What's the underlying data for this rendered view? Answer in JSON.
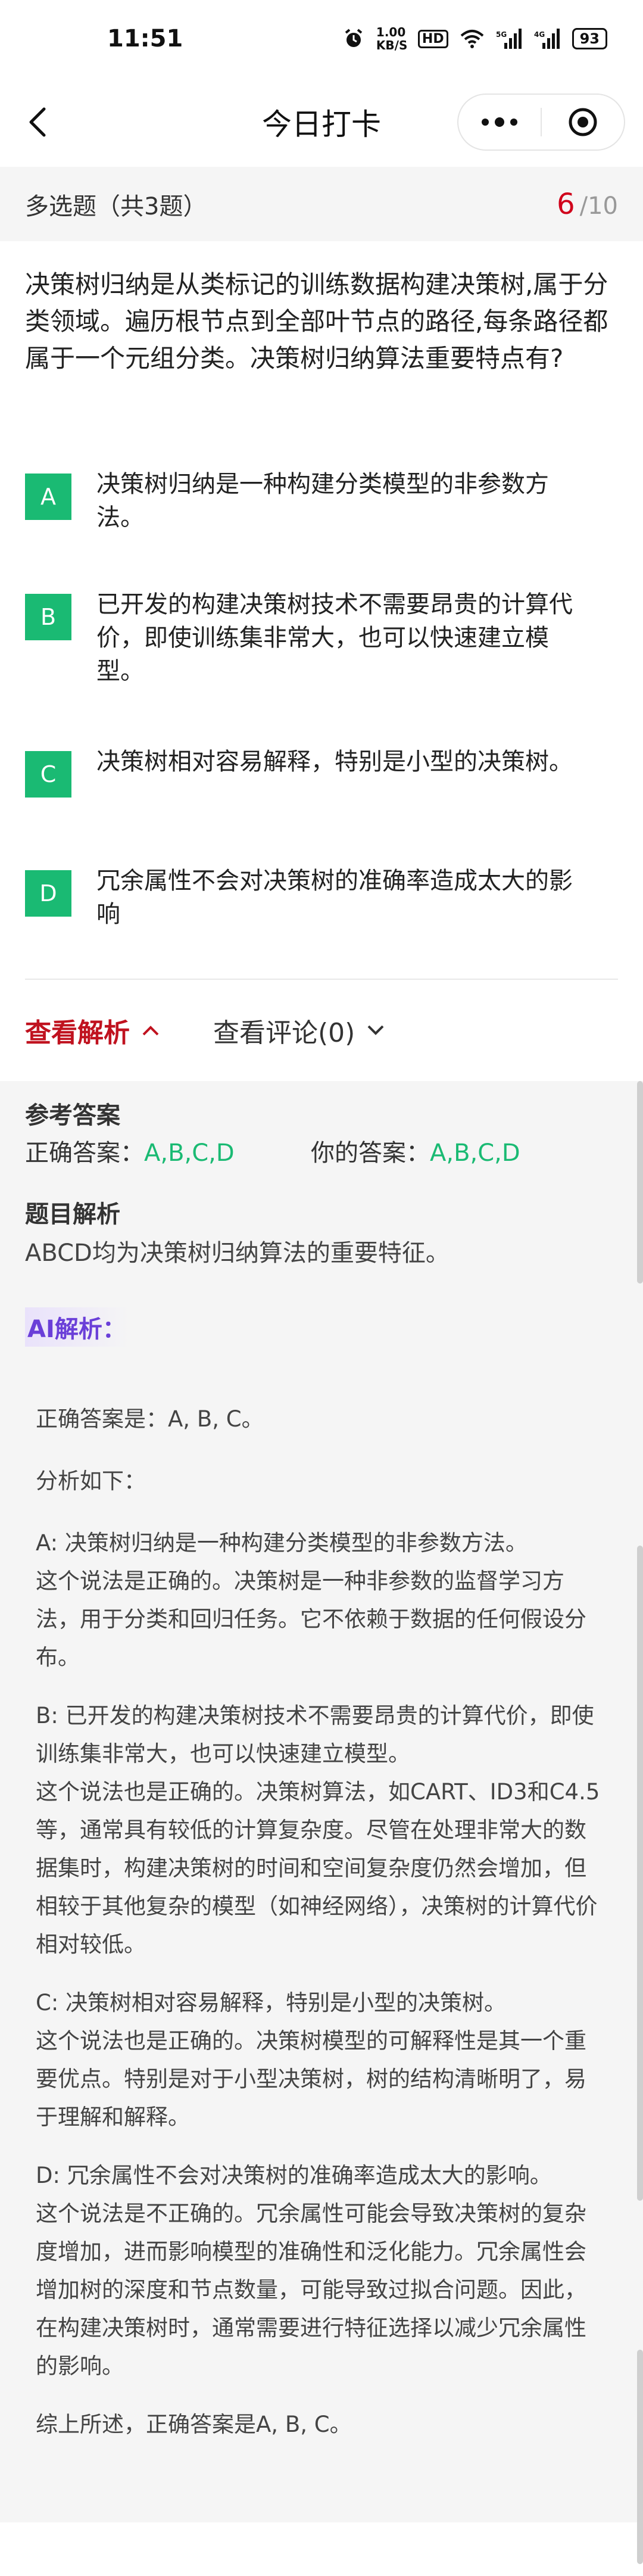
{
  "status_bar": {
    "time": "11:51",
    "net_speed": "1.00 KB/S",
    "hd_badge": "HD",
    "battery": "93",
    "icons": [
      "alarm-icon",
      "wifi-icon",
      "signal-5g-icon",
      "signal-4g-icon",
      "battery-icon"
    ]
  },
  "nav": {
    "title": "今日打卡",
    "back_icon": "chevron-left-icon",
    "more_icon": "more-dots-icon",
    "close_icon": "target-close-icon"
  },
  "question_header": {
    "type_label": "多选题（共3题）",
    "current": "6",
    "total": "/10"
  },
  "question": {
    "text": "决策树归纳是从类标记的训练数据构建决策树,属于分类领域。遍历根节点到全部叶节点的路径,每条路径都属于一个元组分类。决策树归纳算法重要特点有?",
    "options": [
      {
        "letter": "A",
        "text": "决策树归纳是一种构建分类模型的非参数方法。"
      },
      {
        "letter": "B",
        "text": "已开发的构建决策树技术不需要昂贵的计算代价，即使训练集非常大，也可以快速建立模型。"
      },
      {
        "letter": "C",
        "text": "决策树相对容易解释，特别是小型的决策树。"
      },
      {
        "letter": "D",
        "text": "冗余属性不会对决策树的准确率造成太大的影响"
      }
    ]
  },
  "tabs": {
    "analysis": "查看解析",
    "comments": "查看评论(0)"
  },
  "colors": {
    "accent_green": "#1aba73",
    "accent_red": "#c0121f",
    "ai_purple": "#6a3fd8"
  },
  "analysis": {
    "ref_title": "参考答案",
    "correct_label": "正确答案：",
    "correct_value": "A,B,C,D",
    "yours_label": "你的答案：",
    "yours_value": "A,B,C,D",
    "jiexi_title": "题目解析",
    "jiexi_text": "ABCD均为决策树归纳算法的重要特征。",
    "ai_title": "AI解析：",
    "ai": {
      "p1": "正确答案是：A, B, C。",
      "p2": "分析如下：",
      "a_head": "A: 决策树归纳是一种构建分类模型的非参数方法。",
      "a_body": "这个说法是正确的。决策树是一种非参数的监督学习方法，用于分类和回归任务。它不依赖于数据的任何假设分布。",
      "b_head": "B: 已开发的构建决策树技术不需要昂贵的计算代价，即使训练集非常大，也可以快速建立模型。",
      "b_body": "这个说法也是正确的。决策树算法，如CART、ID3和C4.5等，通常具有较低的计算复杂度。尽管在处理非常大的数据集时，构建决策树的时间和空间复杂度仍然会增加，但相较于其他复杂的模型（如神经网络），决策树的计算代价相对较低。",
      "c_head": "C: 决策树相对容易解释，特别是小型的决策树。",
      "c_body": "这个说法也是正确的。决策树模型的可解释性是其一个重要优点。特别是对于小型决策树，树的结构清晰明了，易于理解和解释。",
      "d_head": "D: 冗余属性不会对决策树的准确率造成太大的影响。",
      "d_body": "这个说法是不正确的。冗余属性可能会导致决策树的复杂度增加，进而影响模型的准确性和泛化能力。冗余属性会增加树的深度和节点数量，可能导致过拟合问题。因此，在构建决策树时，通常需要进行特征选择以减少冗余属性的影响。",
      "summary": "综上所述，正确答案是A, B, C。"
    }
  }
}
